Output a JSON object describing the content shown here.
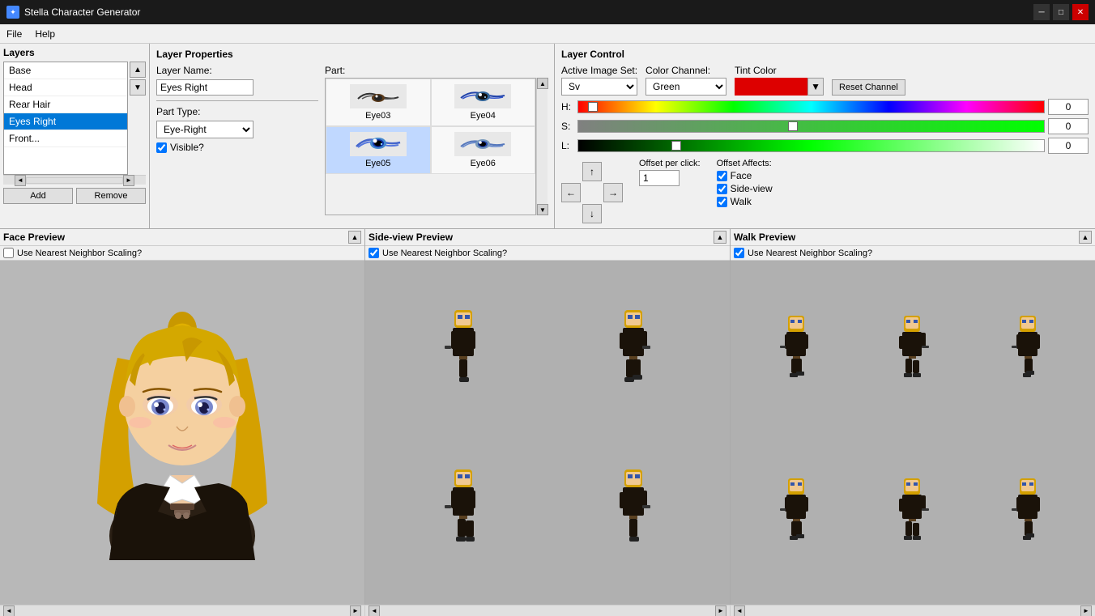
{
  "window": {
    "title": "Stella Character Generator",
    "minimize_label": "─",
    "maximize_label": "□",
    "close_label": "✕"
  },
  "menu": {
    "file_label": "File",
    "help_label": "Help"
  },
  "layers": {
    "panel_title": "Layers",
    "items": [
      {
        "id": "base",
        "label": "Base",
        "selected": false
      },
      {
        "id": "head",
        "label": "Head",
        "selected": false
      },
      {
        "id": "rear-hair",
        "label": "Rear Hair",
        "selected": false
      },
      {
        "id": "eyes-right",
        "label": "Eyes Right",
        "selected": true
      },
      {
        "id": "front",
        "label": "Front...",
        "selected": false
      }
    ],
    "add_label": "Add",
    "remove_label": "Remove"
  },
  "layer_properties": {
    "panel_title": "Layer Properties",
    "layer_name_label": "Layer Name:",
    "layer_name_value": "Eyes Right",
    "part_type_label": "Part Type:",
    "part_type_value": "Eye-Right",
    "visible_label": "Visible?",
    "part_label": "Part:",
    "parts": [
      {
        "id": "eye03",
        "label": "Eye03"
      },
      {
        "id": "eye04",
        "label": "Eye04"
      },
      {
        "id": "eye05",
        "label": "Eye05"
      },
      {
        "id": "eye06",
        "label": "Eye06"
      }
    ]
  },
  "layer_control": {
    "panel_title": "Layer Control",
    "active_image_set_label": "Active Image Set:",
    "active_image_set_value": "Sv",
    "color_channel_label": "Color Channel:",
    "color_channel_value": "Green",
    "tint_color_label": "Tint Color",
    "tint_color_hex": "#dd0000",
    "reset_channel_label": "Reset Channel",
    "h_label": "H:",
    "h_value": "0",
    "s_label": "S:",
    "s_value": "0",
    "l_label": "L:",
    "l_value": "0",
    "offset_per_click_label": "Offset per click:",
    "offset_per_click_value": "1",
    "offset_affects_label": "Offset Affects:",
    "face_label": "Face",
    "sideview_label": "Side-view",
    "walk_label": "Walk",
    "face_checked": true,
    "sideview_checked": true,
    "walk_checked": true
  },
  "face_preview": {
    "panel_title": "Face Preview",
    "nearest_neighbor_label": "Use Nearest Neighbor Scaling?",
    "nearest_neighbor_checked": false
  },
  "sideview_preview": {
    "panel_title": "Side-view Preview",
    "nearest_neighbor_label": "Use Nearest Neighbor Scaling?",
    "nearest_neighbor_checked": true
  },
  "walk_preview": {
    "panel_title": "Walk Preview",
    "nearest_neighbor_label": "Use Nearest Neighbor Scaling?",
    "nearest_neighbor_checked": true
  },
  "arrow_pad": {
    "up": "↑",
    "left": "←",
    "right": "→",
    "down": "↓"
  }
}
